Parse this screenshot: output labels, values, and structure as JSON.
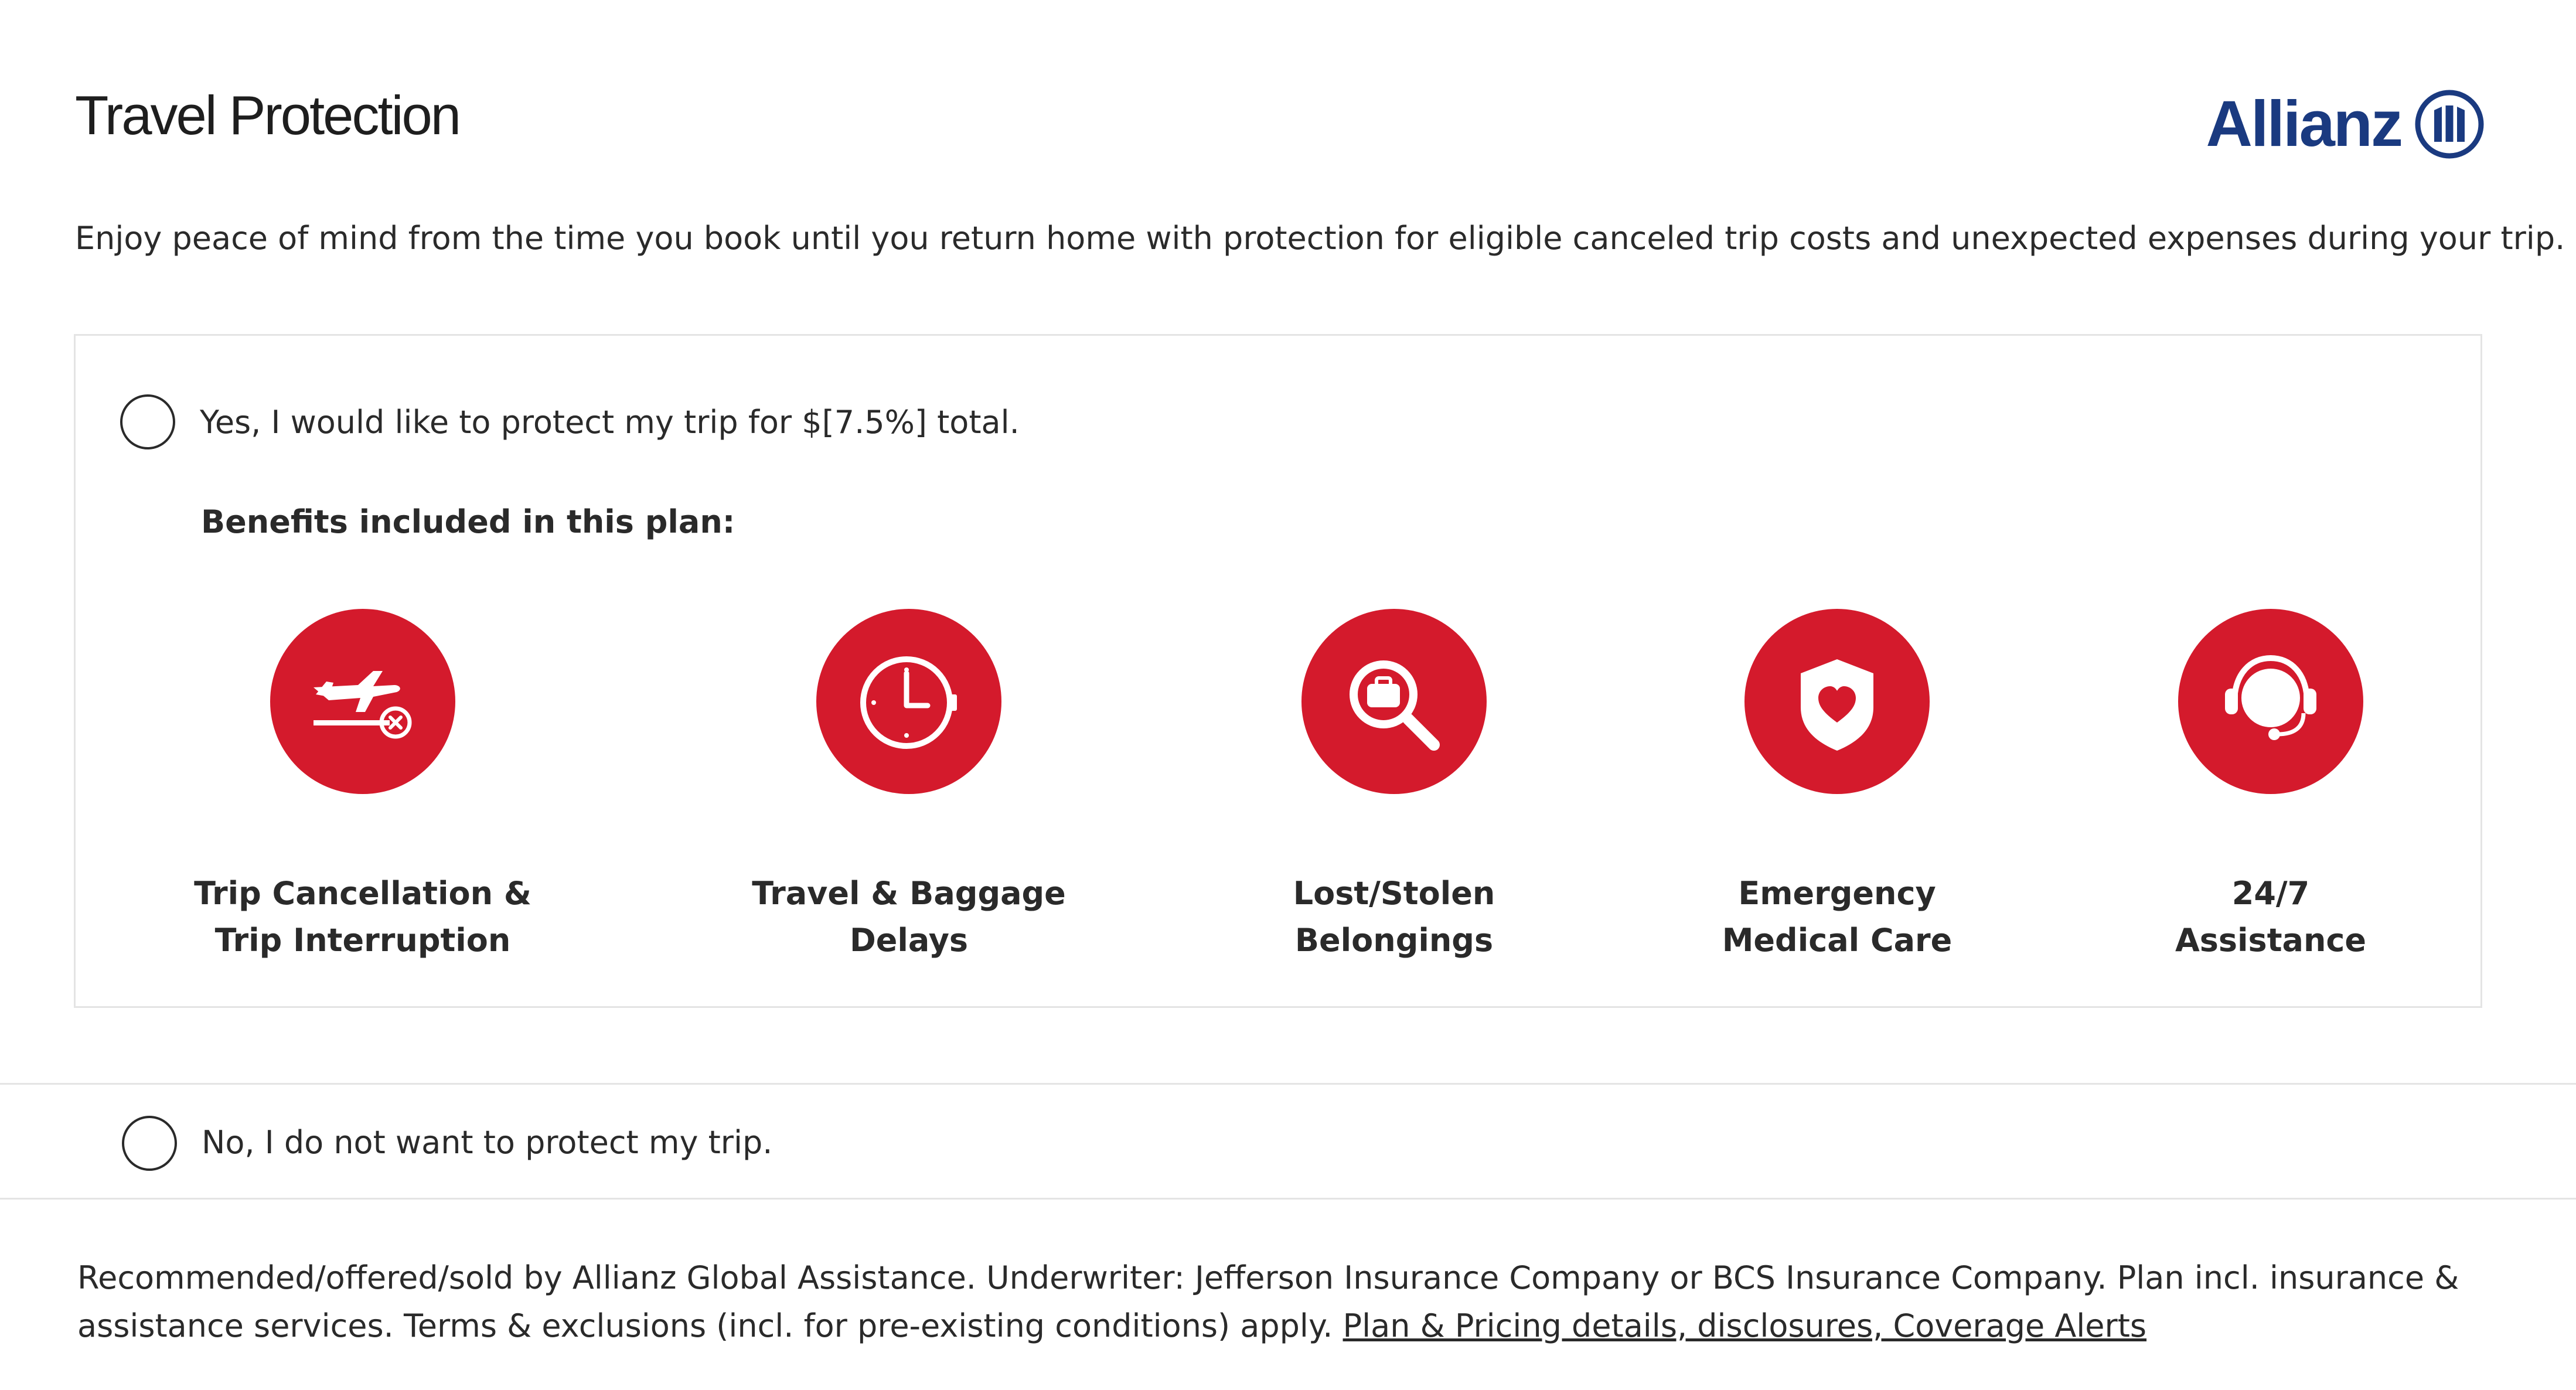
{
  "header": {
    "title": "Travel Protection",
    "logo_text": "Allianz"
  },
  "intro": "Enjoy peace of mind from the time you book until you return home with protection for eligible canceled trip costs and unexpected expenses during your trip.",
  "option_yes": {
    "label": "Yes, I would like to protect my trip for $[7.5%] total.",
    "benefits_heading": "Benefits included in this plan:",
    "benefits": [
      {
        "icon": "plane-cancel-icon",
        "line1": "Trip Cancellation &",
        "line2": "Trip Interruption"
      },
      {
        "icon": "clock-icon",
        "line1": "Travel & Baggage",
        "line2": "Delays"
      },
      {
        "icon": "search-luggage-icon",
        "line1": "Lost/Stolen",
        "line2": "Belongings"
      },
      {
        "icon": "shield-heart-icon",
        "line1": "Emergency",
        "line2": "Medical Care"
      },
      {
        "icon": "headset-icon",
        "line1": "24/7",
        "line2": "Assistance"
      }
    ]
  },
  "option_no": {
    "label": "No, I do not want to protect my trip."
  },
  "disclaimer": {
    "text": "Recommended/offered/sold by Allianz Global Assistance. Underwriter: Jefferson Insurance Company or BCS Insurance Company. Plan incl. insurance & assistance services. Terms & exclusions (incl. for pre-existing conditions) apply.",
    "link": "Plan & Pricing details, disclosures, Coverage Alerts"
  },
  "colors": {
    "brand_red": "#d41a2c",
    "brand_blue": "#1a3a80",
    "text": "#2a2a2a",
    "border": "#e4e4e4"
  }
}
